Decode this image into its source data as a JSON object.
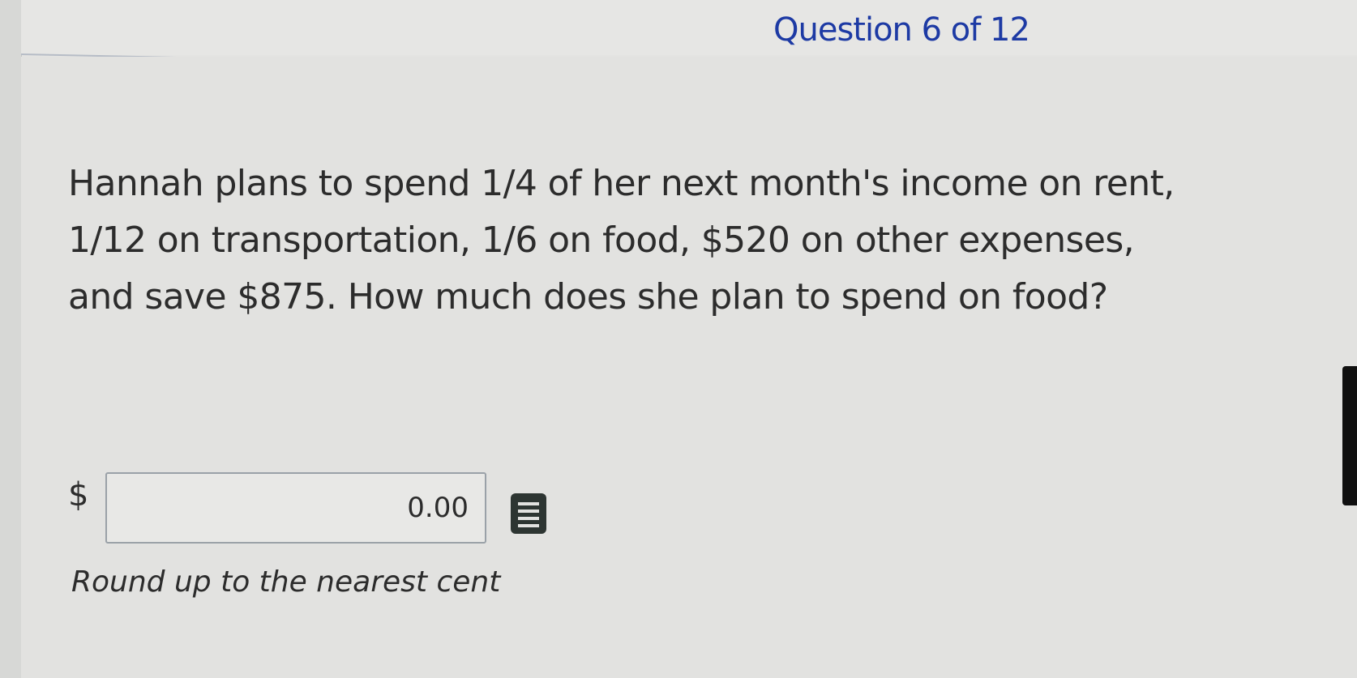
{
  "header": {
    "question_counter": "Question 6 of 12"
  },
  "question": {
    "text": "Hannah plans to spend 1/4 of her next month's income on rent, 1/12 on transportation, 1/6 on food, $520 on other expenses, and save $875. How much does she plan to spend on food?"
  },
  "answer": {
    "currency_symbol": "$",
    "value": "0.00",
    "hint": "Round up to the nearest cent"
  },
  "icons": {
    "calculator": "calculator-icon"
  },
  "colors": {
    "counter_text": "#1d3aa4",
    "body_text": "#2c2c2c",
    "background": "#e2e2e0"
  }
}
